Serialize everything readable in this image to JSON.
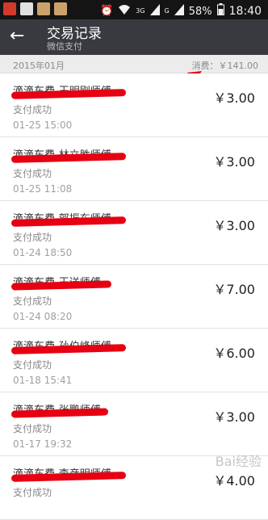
{
  "status_bar": {
    "signal_3g": "3G",
    "signal_g": "G",
    "battery": "58%",
    "time": "18:40",
    "icons": [
      "app-notification-icon",
      "image-icon",
      "app-icon",
      "app-icon",
      "alarm-icon",
      "wifi-icon",
      "signal-icon",
      "battery-icon"
    ]
  },
  "header": {
    "back_icon": "←",
    "title": "交易记录",
    "subtitle": "微信支付"
  },
  "month_bar": {
    "month": "2015年01月",
    "total": "消费：￥141.00"
  },
  "transactions": [
    {
      "name": "滴滴车费-王明刚师傅",
      "status": "支付成功",
      "time": "01-25 15:00",
      "amount": "￥3.00"
    },
    {
      "name": "滴滴车费-林立胜师傅",
      "status": "支付成功",
      "time": "01-25 11:08",
      "amount": "￥3.00"
    },
    {
      "name": "滴滴车费-郭振东师傅",
      "status": "支付成功",
      "time": "01-24 18:50",
      "amount": "￥3.00"
    },
    {
      "name": "滴滴车费-王送师傅",
      "status": "支付成功",
      "time": "01-24 08:20",
      "amount": "￥7.00"
    },
    {
      "name": "滴滴车费-孙伯峰师傅",
      "status": "支付成功",
      "time": "01-18 15:41",
      "amount": "￥6.00"
    },
    {
      "name": "滴滴车费-张鹏师傅",
      "status": "支付成功",
      "time": "01-17 19:32",
      "amount": "￥3.00"
    },
    {
      "name": "滴滴车费-李彦明师傅",
      "status": "支付成功",
      "time": "",
      "amount": "￥4.00"
    }
  ],
  "watermark": "Bai经验",
  "colors": {
    "status_bar": "#141414",
    "header": "#393a3f",
    "month_bar": "#ececec",
    "scribble": "#e60012",
    "arrow": "#e60012"
  }
}
